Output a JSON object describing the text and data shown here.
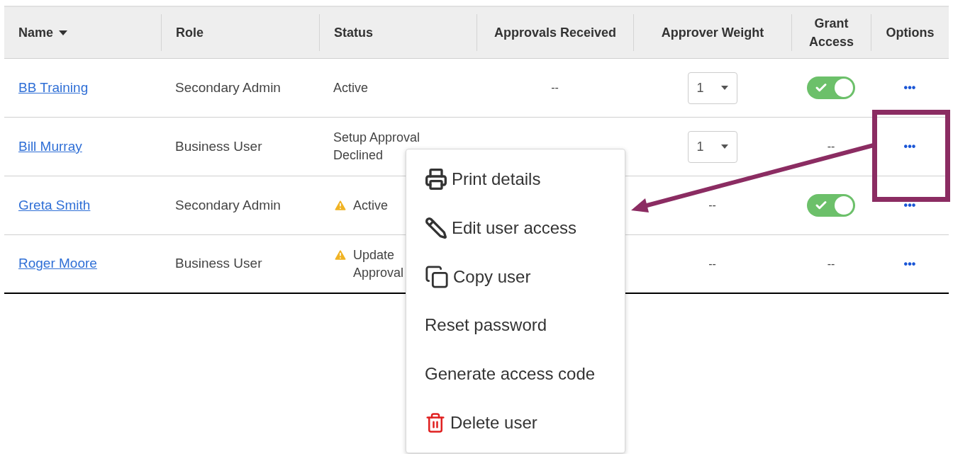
{
  "table": {
    "columns": [
      {
        "label": "Name",
        "sorted": true
      },
      {
        "label": "Role",
        "sorted": false
      },
      {
        "label": "Status",
        "sorted": false
      },
      {
        "label": "Approvals Received",
        "sorted": false
      },
      {
        "label": "Approver Weight",
        "sorted": false
      },
      {
        "label": "Grant Access",
        "sorted": false
      },
      {
        "label": "Options",
        "sorted": false
      }
    ],
    "rows": [
      {
        "name": "BB Training",
        "role": "Secondary Admin",
        "status": "Active",
        "warning": false,
        "approvals": "--",
        "weight": {
          "kind": "select",
          "value": "1"
        },
        "grant": {
          "kind": "toggle",
          "on": true
        },
        "options": "•••"
      },
      {
        "name": "Bill Murray",
        "role": "Business User",
        "status": "Setup Approval Declined",
        "warning": false,
        "weight": {
          "kind": "select",
          "value": "1"
        },
        "grant": {
          "kind": "text",
          "value": "--"
        },
        "options": "•••"
      },
      {
        "name": "Greta Smith",
        "role": "Secondary Admin",
        "status": "Active",
        "warning": true,
        "weight": {
          "kind": "text",
          "value": "--"
        },
        "grant": {
          "kind": "toggle",
          "on": true
        },
        "options": "•••"
      },
      {
        "name": "Roger Moore",
        "role": "Business User",
        "status": "Update Approval",
        "warning": true,
        "weight": {
          "kind": "text",
          "value": "--"
        },
        "grant": {
          "kind": "text",
          "value": "--"
        },
        "options": "•••"
      }
    ]
  },
  "menu": {
    "items": [
      {
        "label": "Print details",
        "kind": "print"
      },
      {
        "label": "Edit user access",
        "kind": "edit"
      },
      {
        "label": "Copy user",
        "kind": "copy"
      },
      {
        "label": "Reset password",
        "kind": "plain"
      },
      {
        "label": "Generate access code",
        "kind": "plain"
      },
      {
        "label": "Delete user",
        "kind": "delete"
      }
    ]
  }
}
